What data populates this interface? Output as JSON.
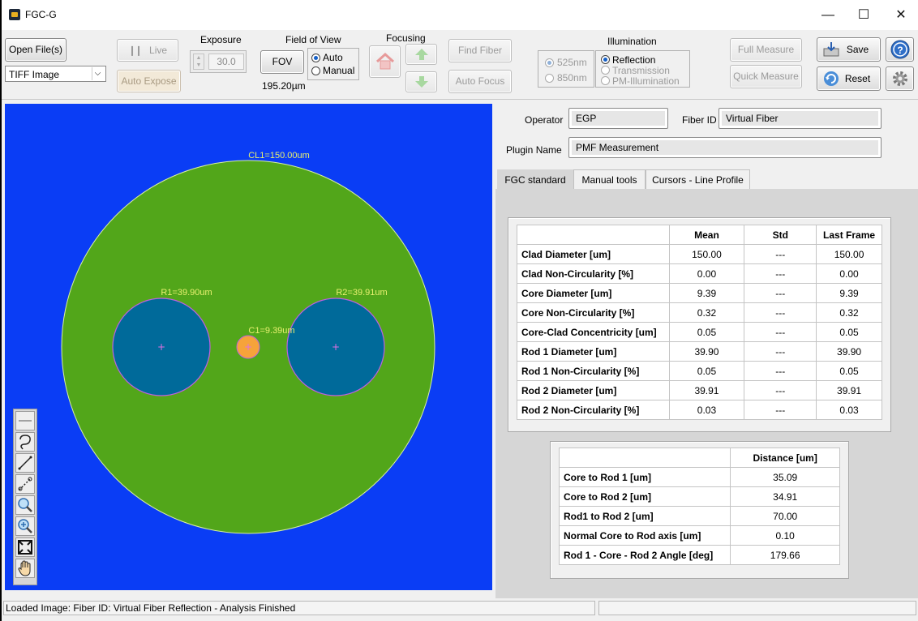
{
  "window": {
    "title": "FGC-G",
    "minimize": "—",
    "maximize": "☐",
    "close": "✕"
  },
  "toolbar": {
    "open_files": "Open File(s)",
    "file_type": "TIFF Image",
    "live": "Live",
    "auto_expose": "Auto Expose",
    "exposure_label": "Exposure",
    "exposure_value": "30.0",
    "fov_label": "Field of View",
    "fov_button": "FOV",
    "fov_value": "195.20µm",
    "fov_auto": "Auto",
    "fov_manual": "Manual",
    "focusing_label": "Focusing",
    "find_fiber": "Find Fiber",
    "auto_focus": "Auto Focus",
    "illumination_label": "Illumination",
    "wl_525": "525nm",
    "wl_850": "850nm",
    "reflection": "Reflection",
    "transmission": "Transmission",
    "pm_illumination": "PM-Illumination",
    "full_measure": "Full Measure",
    "quick_measure": "Quick Measure",
    "save": "Save",
    "reset": "Reset"
  },
  "image": {
    "cl1": "CL1=150.00um",
    "r1": "R1=39.90um",
    "r2": "R2=39.91um",
    "c1": "C1=9.39um",
    "background_color": "#0a3df5",
    "cladding_color": "#52a61a",
    "rod_color": "#006a9a",
    "core_color": "#f6a33a",
    "annotation_color": "#e8f070"
  },
  "info": {
    "operator_label": "Operator",
    "operator_value": "EGP",
    "fiber_id_label": "Fiber ID",
    "fiber_id_value": "Virtual Fiber",
    "plugin_label": "Plugin Name",
    "plugin_value": "PMF Measurement"
  },
  "tabs": [
    "FGC standard",
    "Manual tools",
    "Cursors - Line Profile"
  ],
  "results": {
    "headers": [
      "",
      "Mean",
      "Std",
      "Last Frame"
    ],
    "rows": [
      [
        "Clad Diameter [um]",
        "150.00",
        "---",
        "150.00"
      ],
      [
        "Clad Non-Circularity [%]",
        "0.00",
        "---",
        "0.00"
      ],
      [
        "Core Diameter [um]",
        "9.39",
        "---",
        "9.39"
      ],
      [
        "Core Non-Circularity [%]",
        "0.32",
        "---",
        "0.32"
      ],
      [
        "Core-Clad Concentricity [um]",
        "0.05",
        "---",
        "0.05"
      ],
      [
        "Rod 1 Diameter [um]",
        "39.90",
        "---",
        "39.90"
      ],
      [
        "Rod 1 Non-Circularity [%]",
        "0.05",
        "---",
        "0.05"
      ],
      [
        "Rod 2 Diameter [um]",
        "39.91",
        "---",
        "39.91"
      ],
      [
        "Rod 2 Non-Circularity [%]",
        "0.03",
        "---",
        "0.03"
      ]
    ]
  },
  "distances": {
    "headers": [
      "",
      "Distance [um]"
    ],
    "rows": [
      [
        "Core to Rod 1 [um]",
        "35.09"
      ],
      [
        "Core to Rod 2 [um]",
        "34.91"
      ],
      [
        "Rod1 to Rod 2 [um]",
        "70.00"
      ],
      [
        "Normal Core to Rod axis [um]",
        "0.10"
      ],
      [
        "Rod 1 - Core - Rod 2 Angle [deg]",
        "179.66"
      ]
    ]
  },
  "status": {
    "text": "Loaded Image: Fiber ID: Virtual Fiber Reflection - Analysis Finished"
  },
  "icons": {
    "home": "home-icon",
    "up": "arrow-up-icon",
    "down": "arrow-down-icon",
    "help": "help-icon",
    "settings": "gear-icon",
    "save": "save-icon",
    "reset": "reset-icon"
  }
}
